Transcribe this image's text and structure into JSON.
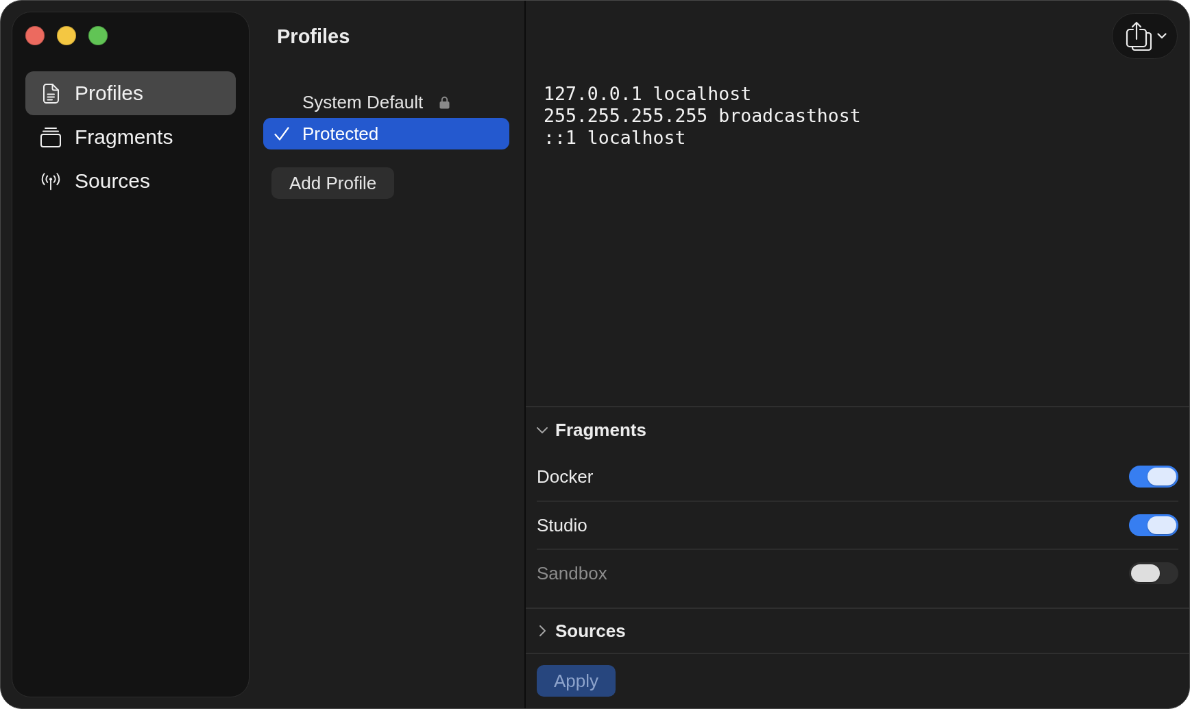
{
  "sidebar": {
    "items": [
      {
        "label": "Profiles",
        "selected": true
      },
      {
        "label": "Fragments",
        "selected": false
      },
      {
        "label": "Sources",
        "selected": false
      }
    ]
  },
  "profiles": {
    "title": "Profiles",
    "items": [
      {
        "label": "System Default",
        "locked": true,
        "selected": false
      },
      {
        "label": "Protected",
        "locked": false,
        "selected": true
      }
    ],
    "add_button": "Add Profile"
  },
  "editor": {
    "lines": [
      "127.0.0.1 localhost",
      "255.255.255.255 broadcasthost",
      "::1 localhost"
    ]
  },
  "sections": [
    {
      "title": "Fragments",
      "expanded": true,
      "items": [
        {
          "label": "Docker",
          "on": true
        },
        {
          "label": "Studio",
          "on": true
        },
        {
          "label": "Sandbox",
          "on": false
        }
      ]
    },
    {
      "title": "Sources",
      "expanded": false
    }
  ],
  "apply_button": {
    "label": "Apply",
    "disabled": true
  }
}
